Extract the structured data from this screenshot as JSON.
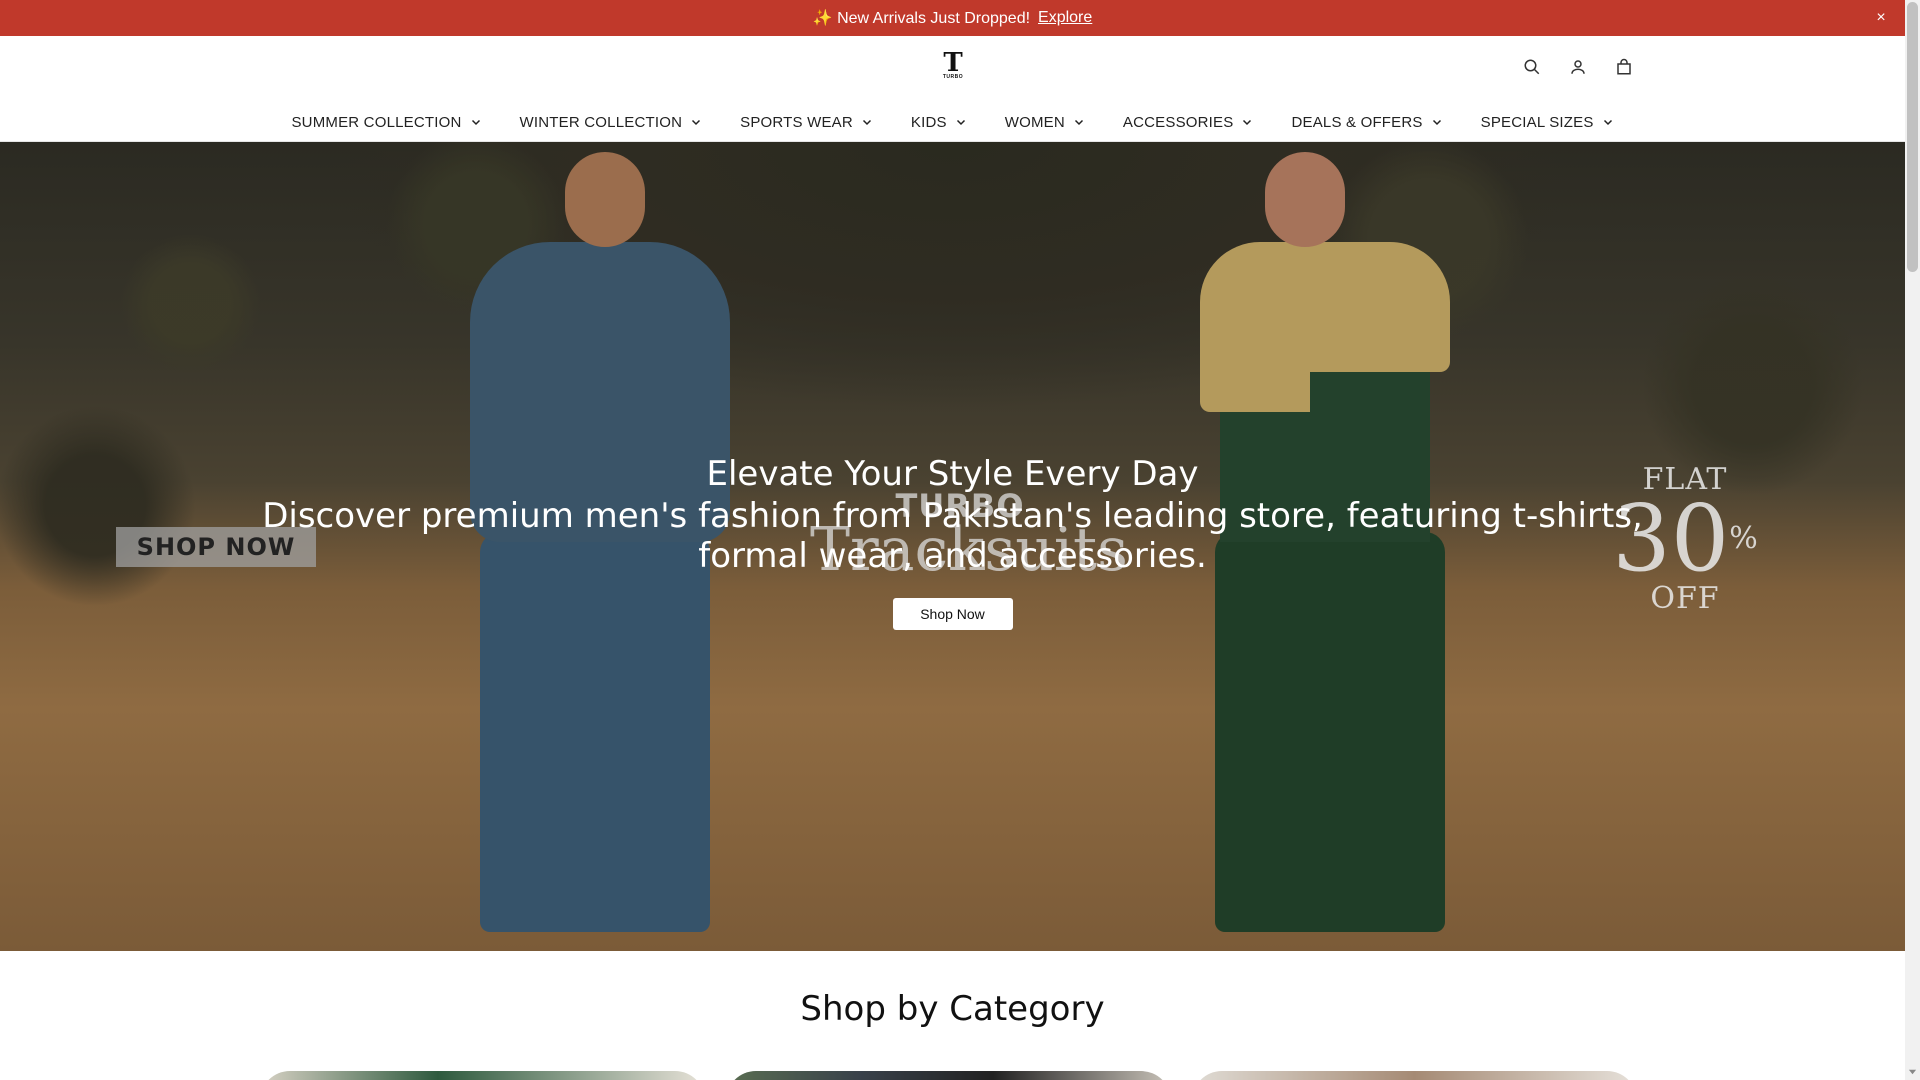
{
  "announcement": {
    "text": "✨ New Arrivals Just Dropped!",
    "link": "Explore",
    "close": "×"
  },
  "header": {
    "logo_mark": "T",
    "logo_word": "TURBO",
    "icons": [
      "search-icon",
      "account-icon",
      "bag-icon"
    ]
  },
  "nav": {
    "items": [
      {
        "label": "SUMMER COLLECTION"
      },
      {
        "label": "WINTER COLLECTION"
      },
      {
        "label": "SPORTS WEAR"
      },
      {
        "label": "KIDS"
      },
      {
        "label": "WOMEN"
      },
      {
        "label": "ACCESSORIES"
      },
      {
        "label": "DEALS & OFFERS"
      },
      {
        "label": "SPECIAL SIZES"
      }
    ]
  },
  "hero": {
    "title": "Elevate Your Style Every Day",
    "subtitle": "Discover premium men's fashion from Pakistan's leading store, featuring t-shirts, formal wear, and accessories.",
    "button": "Shop Now",
    "banner_shop": "SHOP NOW",
    "banner_brand": "TURBO",
    "banner_product": "Tracksuits",
    "banner_flat": "FLAT",
    "banner_amount": "30",
    "banner_percent": "%",
    "banner_off": "OFF"
  },
  "category": {
    "title": "Shop by Category"
  },
  "colors": {
    "announcement_bg": "#c0392b",
    "accent": "#ffffff"
  }
}
